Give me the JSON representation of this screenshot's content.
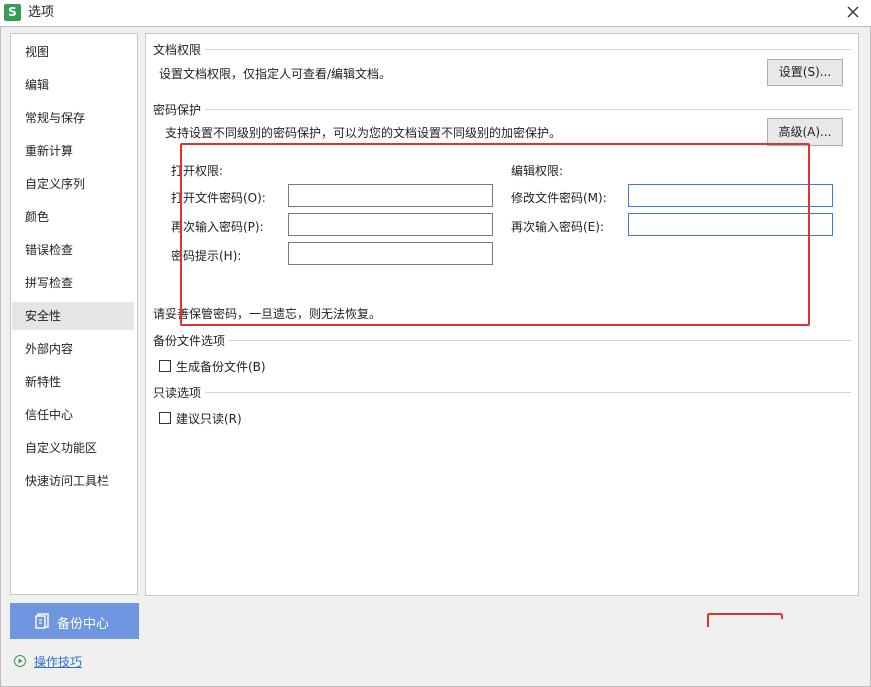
{
  "window": {
    "title": "选项",
    "app_icon_letter": "S"
  },
  "sidebar": {
    "items": [
      {
        "label": "视图"
      },
      {
        "label": "编辑"
      },
      {
        "label": "常规与保存"
      },
      {
        "label": "重新计算"
      },
      {
        "label": "自定义序列"
      },
      {
        "label": "颜色"
      },
      {
        "label": "错误检查"
      },
      {
        "label": "拼写检查"
      },
      {
        "label": "安全性",
        "selected": true
      },
      {
        "label": "外部内容"
      },
      {
        "label": "新特性"
      },
      {
        "label": "信任中心"
      },
      {
        "label": "自定义功能区"
      },
      {
        "label": "快速访问工具栏"
      }
    ]
  },
  "doc_permission": {
    "title": "文档权限",
    "description": "设置文档权限，仅指定人可查看/编辑文档。",
    "button": "设置(S)..."
  },
  "password_protection": {
    "title": "密码保护",
    "description": "支持设置不同级别的密码保护，可以为您的文档设置不同级别的加密保护。",
    "advanced_button": "高级(A)...",
    "open_permission": {
      "heading": "打开权限:",
      "open_password_label": "打开文件密码(O):",
      "reenter_label": "再次输入密码(P):",
      "hint_label": "密码提示(H):",
      "open_password_value": "",
      "reenter_value": "",
      "hint_value": ""
    },
    "edit_permission": {
      "heading": "编辑权限:",
      "modify_password_label": "修改文件密码(M):",
      "reenter_label": "再次输入密码(E):",
      "modify_password_value": "",
      "reenter_value": ""
    },
    "warning": "请妥善保管密码，一旦遗忘，则无法恢复。"
  },
  "backup_options": {
    "title": "备份文件选项",
    "checkbox_label": "生成备份文件(B)",
    "checked": false
  },
  "readonly_options": {
    "title": "只读选项",
    "checkbox_label": "建议只读(R)",
    "checked": false
  },
  "footer": {
    "backup_center": "备份中心",
    "tips": "操作技巧"
  },
  "colors": {
    "accent": "#6f96e0",
    "highlight_box": "#e4312b",
    "link": "#2f6fcf",
    "input_focus": "#3b7bd4"
  }
}
